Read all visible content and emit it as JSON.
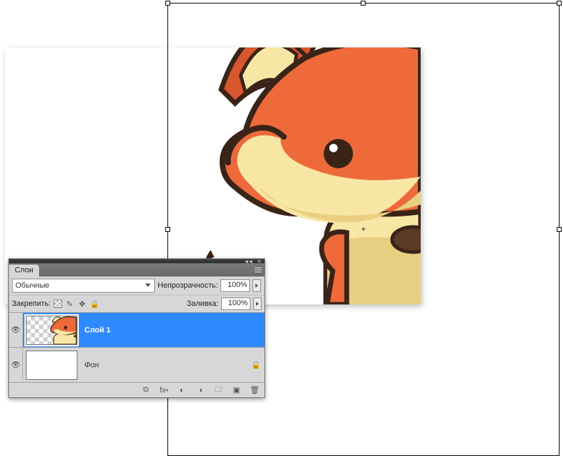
{
  "panel": {
    "title": "Слои",
    "blend_mode": "Обычные",
    "opacity_label": "Непрозрачность:",
    "opacity_value": "100%",
    "lock_label": "Закрепить:",
    "fill_label": "Заливка:",
    "fill_value": "100%"
  },
  "layers": [
    {
      "name": "Слой 1",
      "visible": true,
      "selected": true,
      "locked": false
    },
    {
      "name": "Фон",
      "visible": true,
      "selected": false,
      "locked": true
    }
  ],
  "icons": {
    "eye": "👁",
    "lock": "🔒",
    "brush": "✎",
    "move": "✥",
    "link": "⧉",
    "fx": "fx",
    "mask": "◐",
    "adjust": "◑",
    "folder": "🗀",
    "new": "▣",
    "trash": "🗑"
  },
  "colors": {
    "fox_body": "#ee6a3a",
    "fox_dark": "#d8582e",
    "fox_cream": "#f8e6a5",
    "fox_cream_dark": "#e8cf82",
    "outline": "#3a2418",
    "nose": "#5b3a27",
    "selection": "#2f8aff"
  }
}
